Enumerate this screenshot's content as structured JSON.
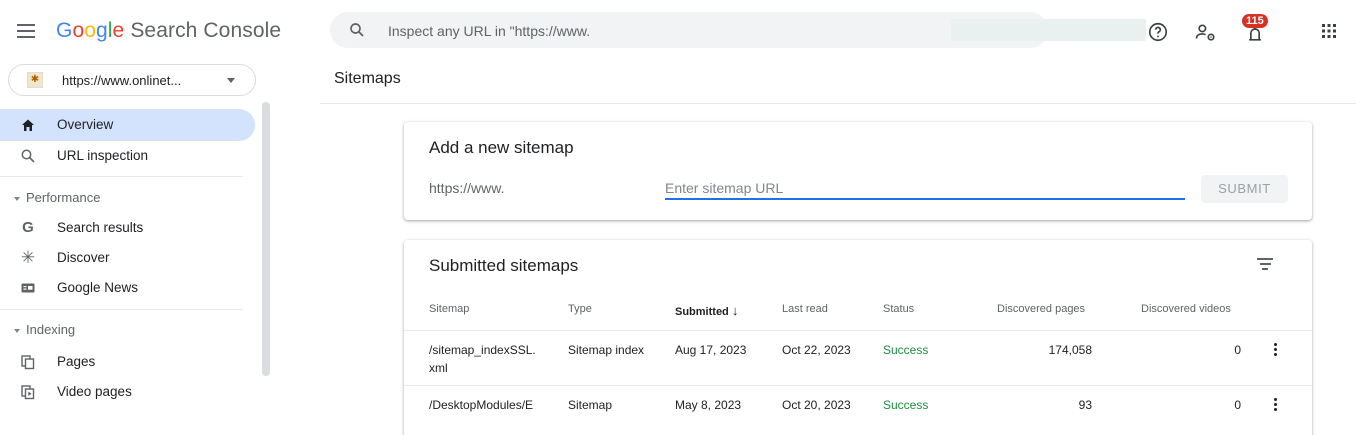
{
  "app": {
    "logo_google": [
      "G",
      "o",
      "o",
      "g",
      "l",
      "e"
    ],
    "logo_product": "Search Console"
  },
  "search": {
    "placeholder": "Inspect any URL in \"https://www."
  },
  "header": {
    "notifications_count": "115"
  },
  "property": {
    "label": "https://www.onlinet..."
  },
  "page": {
    "title": "Sitemaps"
  },
  "sidebar": {
    "items": [
      {
        "label": "Overview",
        "icon": "home-icon"
      },
      {
        "label": "URL inspection",
        "icon": "search-icon"
      },
      {
        "label": "Search results",
        "icon": "google-g-icon"
      },
      {
        "label": "Discover",
        "icon": "asterisk-icon"
      },
      {
        "label": "Google News",
        "icon": "news-icon"
      },
      {
        "label": "Pages",
        "icon": "pages-icon"
      },
      {
        "label": "Video pages",
        "icon": "video-pages-icon"
      }
    ],
    "sections": {
      "performance": "Performance",
      "indexing": "Indexing"
    }
  },
  "add_sitemap": {
    "title": "Add a new sitemap",
    "prefix": "https://www.",
    "input_placeholder": "Enter sitemap URL",
    "submit_label": "SUBMIT"
  },
  "submitted": {
    "title": "Submitted sitemaps",
    "columns": [
      "Sitemap",
      "Type",
      "Submitted",
      "Last read",
      "Status",
      "Discovered pages",
      "Discovered videos"
    ],
    "rows": [
      {
        "sitemap_line1": "/sitemap_indexSSL.",
        "sitemap_line2": "xml",
        "type": "Sitemap index",
        "submitted": "Aug 17, 2023",
        "last_read": "Oct 22, 2023",
        "status": "Success",
        "pages": "174,058",
        "videos": "0"
      },
      {
        "sitemap_line1": "/DesktopModules/E",
        "sitemap_line2": "",
        "type": "Sitemap",
        "submitted": "May 8, 2023",
        "last_read": "Oct 20, 2023",
        "status": "Success",
        "pages": "93",
        "videos": "0"
      }
    ]
  },
  "colors": {
    "brand_blue": "#1a73e8",
    "active_nav": "#d3e3fd",
    "success": "#1e8e3e",
    "badge_red": "#d93025"
  }
}
